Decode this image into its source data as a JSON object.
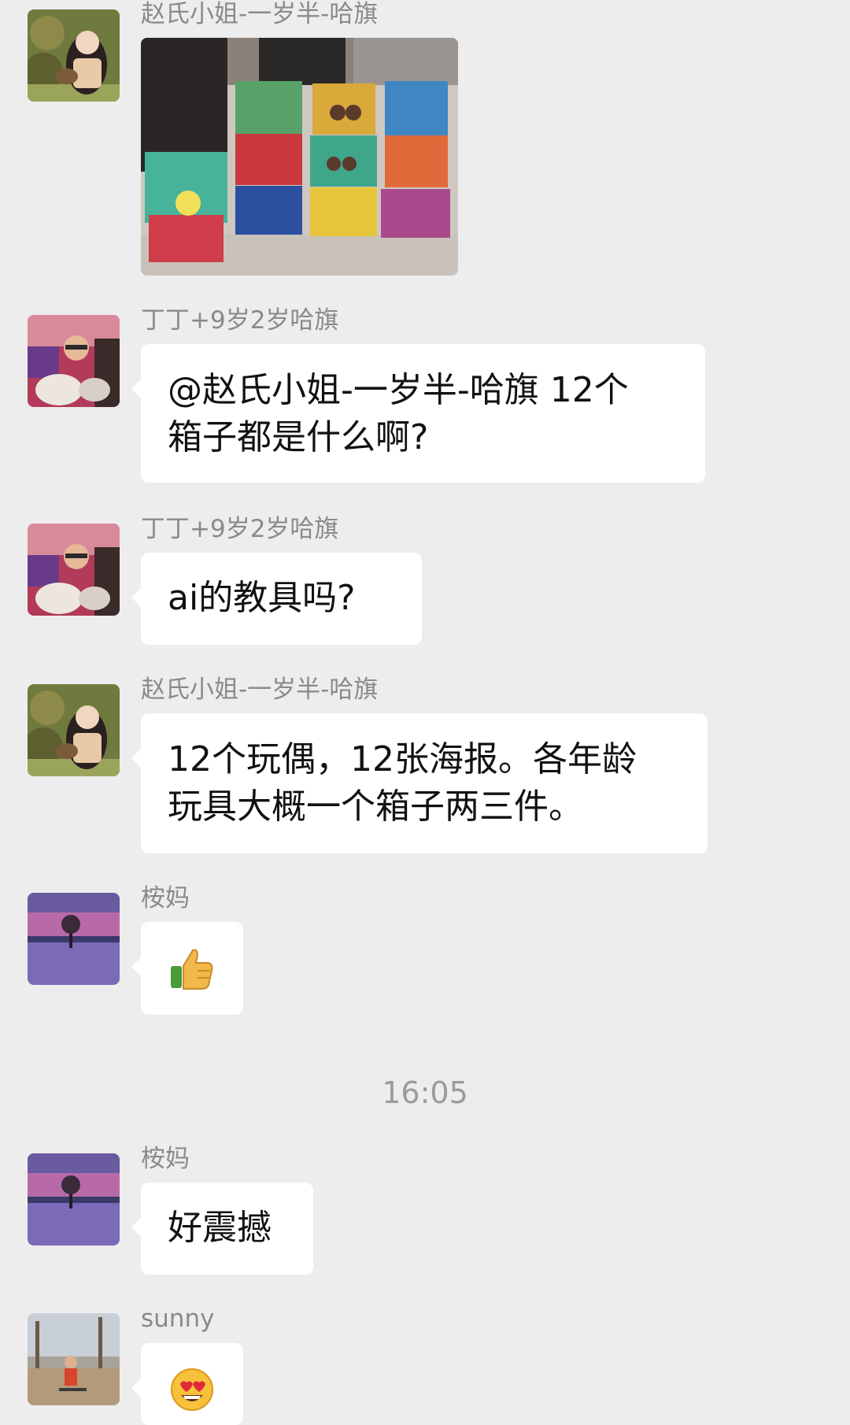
{
  "messages": [
    {
      "sender": "赵氏小姐-一岁半-哈旗",
      "avatar": "woman-reading-avatar",
      "type": "image",
      "image": "stacked-colorful-toy-boxes-photo"
    },
    {
      "sender": "丁丁+9岁2岁哈旗",
      "avatar": "boy-drummer-avatar",
      "type": "text",
      "lines": [
        "@赵氏小姐-一岁半-哈旗 12个",
        "箱子都是什么啊?"
      ]
    },
    {
      "sender": "丁丁+9岁2岁哈旗",
      "avatar": "boy-drummer-avatar",
      "type": "text",
      "lines": [
        "ai的教具吗?"
      ]
    },
    {
      "sender": "赵氏小姐-一岁半-哈旗",
      "avatar": "woman-reading-avatar",
      "type": "text",
      "lines": [
        "12个玩偶，12张海报。各年龄",
        "玩具大概一个箱子两三件。"
      ]
    },
    {
      "sender": "桉妈",
      "avatar": "lake-tree-sunset-avatar",
      "type": "emoji",
      "emoji": "thumbs-up-emoji"
    },
    {
      "sender": "桉妈",
      "avatar": "lake-tree-sunset-avatar",
      "type": "text",
      "lines": [
        "好震撼"
      ]
    },
    {
      "sender": "sunny",
      "avatar": "child-scooter-avatar",
      "type": "emoji",
      "emoji": "heart-eyes-emoji"
    }
  ],
  "timestamp": "16:05",
  "colors": {
    "background": "#ededed",
    "bubble": "#ffffff",
    "sender_text": "#8a8a8a"
  }
}
